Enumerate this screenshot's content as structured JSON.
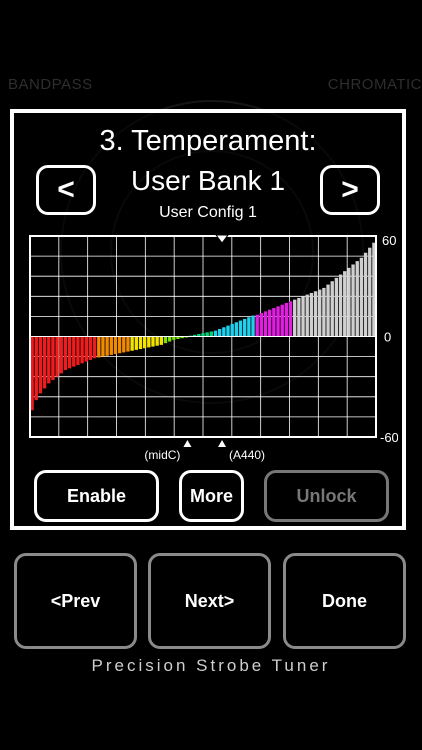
{
  "background": {
    "left_label": "BANDPASS",
    "right_label": "CHROMATIC"
  },
  "panel": {
    "title": "3. Temperament:",
    "bank_name": "User Bank 1",
    "bank_config": "User Config 1",
    "prev_label": "<",
    "next_label": ">"
  },
  "chart_data": {
    "type": "bar",
    "ylim": [
      -60,
      60
    ],
    "y_tick_labels": {
      "top": "60",
      "mid": "0",
      "bottom": "-60"
    },
    "x_markers": {
      "midc": "(midC)",
      "a440": "(A440)"
    },
    "grid": true,
    "series": [
      {
        "color": "#ee1c1c",
        "values": [
          -44,
          -38,
          -34,
          -31,
          -28,
          -26,
          -24,
          -22,
          -20,
          -19,
          -18,
          -17,
          -16,
          -15,
          -14,
          -13
        ]
      },
      {
        "color": "#f08a00",
        "values": [
          -12.5,
          -12,
          -11.5,
          -11,
          -10.5,
          -10,
          -9.5,
          -9
        ]
      },
      {
        "color": "#f2e300",
        "values": [
          -8.5,
          -8,
          -7.5,
          -7,
          -6.5,
          -6,
          -5.5,
          -5
        ]
      },
      {
        "color": "#7ce000",
        "values": [
          -4,
          -3,
          -2,
          -1.5,
          -1,
          -0.5
        ]
      },
      {
        "color": "#00d27a",
        "values": [
          0.5,
          1,
          1.5,
          2,
          2.5,
          3
        ]
      },
      {
        "color": "#1ed2ee",
        "values": [
          3.5,
          4.5,
          5.5,
          6.5,
          7.5,
          8.5,
          9.5,
          10.5,
          11.5,
          12.5
        ]
      },
      {
        "color": "#e21ee2",
        "values": [
          13,
          14,
          15,
          16,
          17,
          18,
          19,
          20,
          21
        ]
      },
      {
        "color": "#cfcfcf",
        "values": [
          22,
          23,
          24,
          25,
          26,
          27,
          28,
          29,
          31,
          33,
          35,
          37,
          39,
          41,
          43,
          45,
          47,
          50,
          53,
          56
        ]
      }
    ]
  },
  "buttons": {
    "enable": "Enable",
    "more": "More",
    "unlock": "Unlock",
    "prev": "<Prev",
    "next": "Next>",
    "done": "Done"
  },
  "footer": "Precision Strobe Tuner"
}
